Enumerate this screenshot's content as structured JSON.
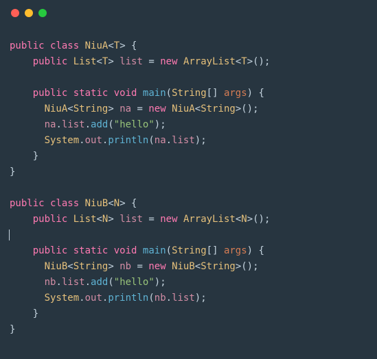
{
  "titlebar": {
    "dots": [
      "red",
      "yellow",
      "green"
    ]
  },
  "code": {
    "mod_public": "public",
    "kw_class": "class",
    "kw_static": "static",
    "kw_void": "void",
    "kw_new": "new",
    "type_List": "List",
    "type_ArrayList": "ArrayList",
    "type_String": "String",
    "type_System": "System",
    "func_main": "main",
    "func_add": "add",
    "func_println": "println",
    "field_list": "list",
    "field_out": "out",
    "arg_args": "args",
    "className_A": "NiuA",
    "className_B": "NiuB",
    "generic_T": "T",
    "generic_N": "N",
    "var_na": "na",
    "var_nb": "nb",
    "str_hello": "\"hello\"",
    "eq": " = "
  }
}
